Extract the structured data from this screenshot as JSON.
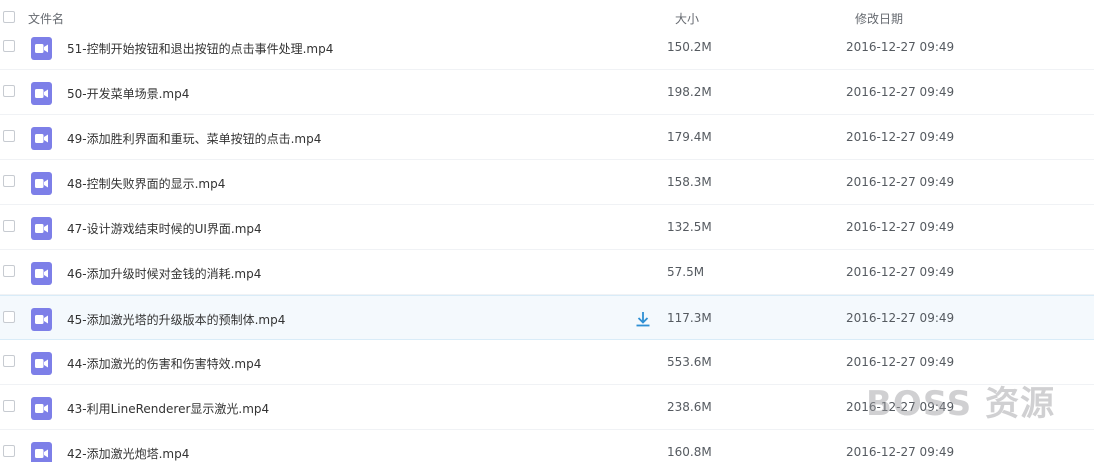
{
  "header": {
    "name_label": "文件名",
    "size_label": "大小",
    "date_label": "修改日期"
  },
  "files": [
    {
      "name": "51-控制开始按钮和退出按钮的点击事件处理.mp4",
      "size": "150.2M",
      "date": "2016-12-27 09:49"
    },
    {
      "name": "50-开发菜单场景.mp4",
      "size": "198.2M",
      "date": "2016-12-27 09:49"
    },
    {
      "name": "49-添加胜利界面和重玩、菜单按钮的点击.mp4",
      "size": "179.4M",
      "date": "2016-12-27 09:49"
    },
    {
      "name": "48-控制失败界面的显示.mp4",
      "size": "158.3M",
      "date": "2016-12-27 09:49"
    },
    {
      "name": "47-设计游戏结束时候的UI界面.mp4",
      "size": "132.5M",
      "date": "2016-12-27 09:49"
    },
    {
      "name": "46-添加升级时候对金钱的消耗.mp4",
      "size": "57.5M",
      "date": "2016-12-27 09:49"
    },
    {
      "name": "45-添加激光塔的升级版本的预制体.mp4",
      "size": "117.3M",
      "date": "2016-12-27 09:49"
    },
    {
      "name": "44-添加激光的伤害和伤害特效.mp4",
      "size": "553.6M",
      "date": "2016-12-27 09:49"
    },
    {
      "name": "43-利用LineRenderer显示激光.mp4",
      "size": "238.6M",
      "date": "2016-12-27 09:49"
    },
    {
      "name": "42-添加激光炮塔.mp4",
      "size": "160.8M",
      "date": "2016-12-27 09:49"
    }
  ],
  "hovered_index": 6,
  "icons": {
    "file": "video-file-icon",
    "download": "download-icon"
  },
  "colors": {
    "video_icon": "#7d7fe8",
    "hover_row": "#f4f9fd",
    "download": "#2e8fd4"
  },
  "watermark": "BOSS 资源"
}
